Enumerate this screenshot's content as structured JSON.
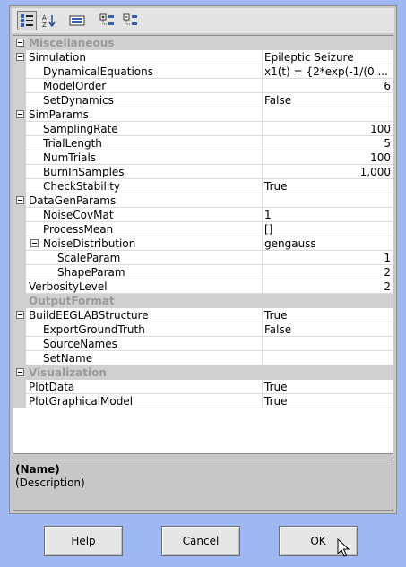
{
  "toolbar": {
    "buttons": [
      {
        "name": "categorized-view-icon",
        "active": true
      },
      {
        "name": "sort-alphabetical-icon",
        "active": false
      },
      {
        "name": "property-pages-icon",
        "active": false
      },
      {
        "name": "expand-all-icon",
        "active": false
      },
      {
        "name": "collapse-all-icon",
        "active": false
      }
    ]
  },
  "grid": {
    "rows": [
      {
        "kind": "category",
        "label": "Miscellaneous",
        "value": "",
        "toggle": true
      },
      {
        "kind": "group",
        "label": "Simulation",
        "value": "Epileptic Seizure",
        "toggle": true
      },
      {
        "kind": "prop",
        "label": "DynamicalEquations",
        "value": "x1(t) = {2*exp(-1/(0....",
        "indent": 1
      },
      {
        "kind": "prop",
        "label": "ModelOrder",
        "value": "6",
        "indent": 1,
        "align": "right"
      },
      {
        "kind": "prop",
        "label": "SetDynamics",
        "value": "False",
        "indent": 1
      },
      {
        "kind": "group",
        "label": "SimParams",
        "value": "",
        "toggle": true
      },
      {
        "kind": "prop",
        "label": "SamplingRate",
        "value": "100",
        "indent": 1,
        "align": "right"
      },
      {
        "kind": "prop",
        "label": "TrialLength",
        "value": "5",
        "indent": 1,
        "align": "right"
      },
      {
        "kind": "prop",
        "label": "NumTrials",
        "value": "100",
        "indent": 1,
        "align": "right"
      },
      {
        "kind": "prop",
        "label": "BurnInSamples",
        "value": "1,000",
        "indent": 1,
        "align": "right"
      },
      {
        "kind": "prop",
        "label": "CheckStability",
        "value": "True",
        "indent": 1
      },
      {
        "kind": "group",
        "label": "DataGenParams",
        "value": "",
        "toggle": true
      },
      {
        "kind": "prop",
        "label": "NoiseCovMat",
        "value": "1",
        "indent": 1
      },
      {
        "kind": "prop",
        "label": "ProcessMean",
        "value": "[]",
        "indent": 1
      },
      {
        "kind": "group",
        "label": "NoiseDistribution",
        "value": "gengauss",
        "indent": 1,
        "toggle": true
      },
      {
        "kind": "prop",
        "label": "ScaleParam",
        "value": "1",
        "indent": 2,
        "align": "right"
      },
      {
        "kind": "prop",
        "label": "ShapeParam",
        "value": "2",
        "indent": 2,
        "align": "right"
      },
      {
        "kind": "prop",
        "label": "VerbosityLevel",
        "value": "2",
        "indent": 0,
        "align": "right"
      },
      {
        "kind": "category",
        "label": "OutputFormat",
        "value": "",
        "toggle": false
      },
      {
        "kind": "group",
        "label": "BuildEEGLABStructure",
        "value": "True",
        "toggle": true
      },
      {
        "kind": "prop",
        "label": "ExportGroundTruth",
        "value": "False",
        "indent": 1
      },
      {
        "kind": "prop",
        "label": "SourceNames",
        "value": "",
        "indent": 1
      },
      {
        "kind": "prop",
        "label": "SetName",
        "value": "",
        "indent": 1
      },
      {
        "kind": "category",
        "label": "Visualization",
        "value": "",
        "toggle": true
      },
      {
        "kind": "prop",
        "label": "PlotData",
        "value": "True",
        "indent": 0
      },
      {
        "kind": "prop",
        "label": "PlotGraphicalModel",
        "value": "True",
        "indent": 0
      }
    ]
  },
  "description": {
    "name": "(Name)",
    "text": "(Description)"
  },
  "buttons": {
    "help": "Help",
    "cancel": "Cancel",
    "ok": "OK"
  }
}
